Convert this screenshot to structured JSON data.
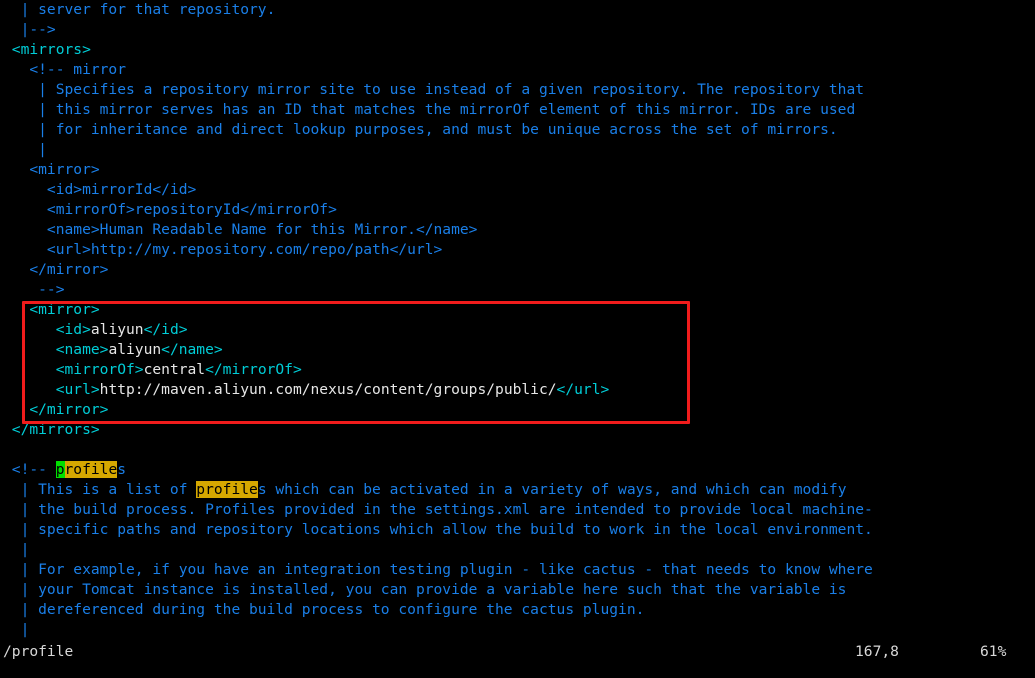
{
  "editor": {
    "app": "vim",
    "filetype": "xml",
    "colors": {
      "background": "#000000",
      "comment": "#1a7fe8",
      "tag": "#00cdd7",
      "text": "#e6e6e6",
      "search_highlight_bg": "#d6a800",
      "search_highlight_fg": "#000000",
      "cursor_bg": "#00e000",
      "annotation_box": "#f01c1c",
      "statusline_fg": "#d8d8d8"
    }
  },
  "lines": [
    {
      "id": "l01",
      "kind": "comment",
      "text": "  | server for that repository."
    },
    {
      "id": "l02",
      "kind": "comment",
      "text": "  |-->"
    },
    {
      "id": "l03",
      "kind": "tag",
      "text": " <mirrors>"
    },
    {
      "id": "l04",
      "kind": "comment",
      "text": "   <!-- mirror"
    },
    {
      "id": "l05",
      "kind": "comment",
      "text": "    | Specifies a repository mirror site to use instead of a given repository. The repository that"
    },
    {
      "id": "l06",
      "kind": "comment",
      "text": "    | this mirror serves has an ID that matches the mirrorOf element of this mirror. IDs are used"
    },
    {
      "id": "l07",
      "kind": "comment",
      "text": "    | for inheritance and direct lookup purposes, and must be unique across the set of mirrors."
    },
    {
      "id": "l08",
      "kind": "comment",
      "text": "    |"
    },
    {
      "id": "l09",
      "kind": "comment",
      "text": "   <mirror>"
    },
    {
      "id": "l10",
      "kind": "comment",
      "text": "     <id>mirrorId</id>"
    },
    {
      "id": "l11",
      "kind": "comment",
      "text": "     <mirrorOf>repositoryId</mirrorOf>"
    },
    {
      "id": "l12",
      "kind": "comment",
      "text": "     <name>Human Readable Name for this Mirror.</name>"
    },
    {
      "id": "l13",
      "kind": "comment",
      "text": "     <url>http://my.repository.com/repo/path</url>"
    },
    {
      "id": "l14",
      "kind": "comment",
      "text": "   </mirror>"
    },
    {
      "id": "l15",
      "kind": "comment",
      "text": "    -->"
    },
    {
      "id": "l16",
      "kind": "xml",
      "indent": "   ",
      "open": "<mirror>"
    },
    {
      "id": "l17",
      "kind": "xml-el",
      "indent": "      ",
      "open": "<id>",
      "value": "aliyun",
      "close": "</id>"
    },
    {
      "id": "l18",
      "kind": "xml-el",
      "indent": "      ",
      "open": "<name>",
      "value": "aliyun",
      "close": "</name>"
    },
    {
      "id": "l19",
      "kind": "xml-el",
      "indent": "      ",
      "open": "<mirrorOf>",
      "value": "central",
      "close": "</mirrorOf>"
    },
    {
      "id": "l20",
      "kind": "xml-el",
      "indent": "      ",
      "open": "<url>",
      "value": "http://maven.aliyun.com/nexus/content/groups/public/",
      "close": "</url>"
    },
    {
      "id": "l21",
      "kind": "xml",
      "indent": "   ",
      "open": "</mirror>"
    },
    {
      "id": "l22",
      "kind": "tag",
      "text": " </mirrors>"
    },
    {
      "id": "l23",
      "kind": "blank",
      "text": ""
    },
    {
      "id": "l24",
      "kind": "match-cursor",
      "pre": " <!-- ",
      "cursor": "p",
      "match": "rofile",
      "post": "s"
    },
    {
      "id": "l25",
      "kind": "match",
      "pre": "  | This is a list of ",
      "match": "profile",
      "post": "s which can be activated in a variety of ways, and which can modify"
    },
    {
      "id": "l26",
      "kind": "comment",
      "text": "  | the build process. Profiles provided in the settings.xml are intended to provide local machine-"
    },
    {
      "id": "l27",
      "kind": "comment",
      "text": "  | specific paths and repository locations which allow the build to work in the local environment."
    },
    {
      "id": "l28",
      "kind": "comment",
      "text": "  |"
    },
    {
      "id": "l29",
      "kind": "comment",
      "text": "  | For example, if you have an integration testing plugin - like cactus - that needs to know where"
    },
    {
      "id": "l30",
      "kind": "comment",
      "text": "  | your Tomcat instance is installed, you can provide a variable here such that the variable is"
    },
    {
      "id": "l31",
      "kind": "comment",
      "text": "  | dereferenced during the build process to configure the cactus plugin."
    },
    {
      "id": "l32",
      "kind": "comment",
      "text": "  |"
    }
  ],
  "annotation": {
    "label": "aliyun-mirror-highlight-box",
    "color": "#f01c1c"
  },
  "statusline": {
    "filename": "/profile",
    "position": "167,8",
    "percent": "61%"
  }
}
